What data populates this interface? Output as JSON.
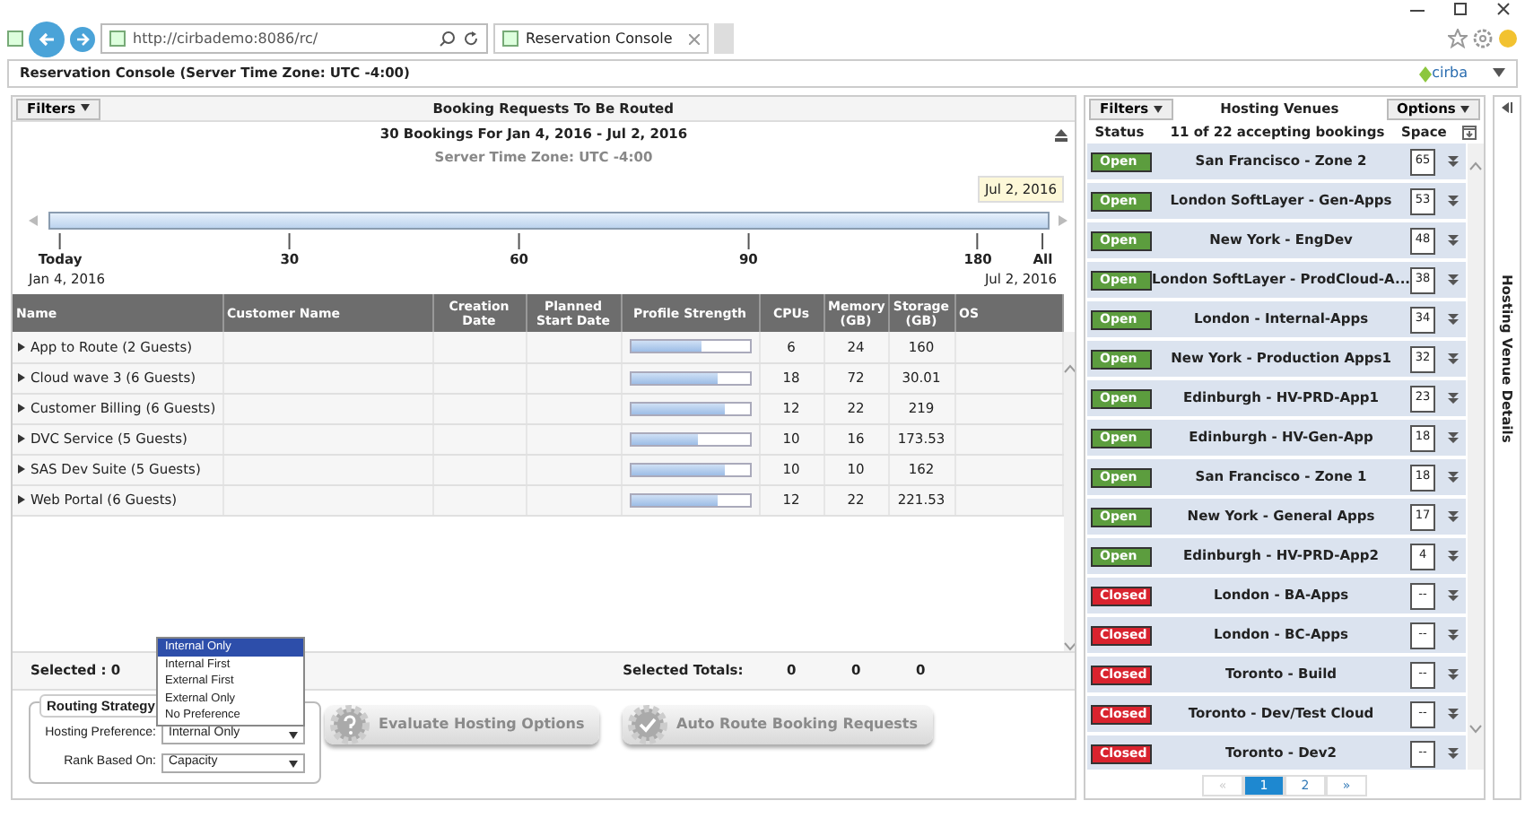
{
  "browser": {
    "address": "http://cirbademo:8086/rc/",
    "tab_title": "Reservation Console"
  },
  "app_title": "Reservation Console (Server Time Zone: UTC -4:00)",
  "logo": "cirba",
  "bookings": {
    "filters_label": "Filters",
    "title": "Booking Requests To Be Routed",
    "range": "30 Bookings For Jan 4, 2016 - Jul 2, 2016",
    "time_zone": "Server Time Zone: UTC -4:00",
    "timeline": {
      "level": 1,
      "tooltip": "Jul 2, 2016",
      "ticks": [
        "Today",
        "30",
        "60",
        "90",
        "180",
        "All"
      ],
      "start": "Jan 4, 2016",
      "end": "Jul 2, 2016"
    },
    "columns": [
      "Name",
      "Customer Name",
      "Creation Date",
      "Planned Start Date",
      "Profile Strength",
      "CPUs",
      "Memory (GB)",
      "Storage (GB)",
      "OS"
    ],
    "rows": [
      {
        "name": "App to Route (2 Guests)",
        "level": 0.6,
        "cpus": "6",
        "memory": "24",
        "storage": "160"
      },
      {
        "name": "Cloud wave 3 (6 Guests)",
        "level": 0.73,
        "cpus": "18",
        "memory": "72",
        "storage": "30.01"
      },
      {
        "name": "Customer Billing (6 Guests)",
        "level": 0.8,
        "cpus": "12",
        "memory": "22",
        "storage": "219"
      },
      {
        "name": "DVC Service (5 Guests)",
        "level": 0.57,
        "cpus": "10",
        "memory": "16",
        "storage": "173.53"
      },
      {
        "name": "SAS Dev Suite (5 Guests)",
        "level": 0.8,
        "cpus": "10",
        "memory": "10",
        "storage": "162"
      },
      {
        "name": "Web Portal (6 Guests)",
        "level": 0.73,
        "cpus": "12",
        "memory": "22",
        "storage": "221.53"
      }
    ],
    "selected": "Selected : 0",
    "totals_label": "Selected Totals:",
    "totals": [
      "0",
      "0",
      "0"
    ]
  },
  "routing": {
    "legend": "Routing Strategy",
    "fields": [
      {
        "label": "Hosting Preference:",
        "value": "Internal Only"
      },
      {
        "label": "Rank Based On:",
        "value": "Capacity"
      }
    ],
    "menu": [
      {
        "label": "Internal Only",
        "selected": true
      },
      {
        "label": "Internal First",
        "selected": false
      },
      {
        "label": "External First",
        "selected": false
      },
      {
        "label": "External Only",
        "selected": false
      },
      {
        "label": "No Preference",
        "selected": false
      }
    ]
  },
  "actions": [
    {
      "kind": "evaluate",
      "label": "Evaluate Hosting Options",
      "disabled": true
    },
    {
      "kind": "auto",
      "label": "Auto Route Booking Requests",
      "disabled": true
    }
  ],
  "venues": {
    "filters_label": "Filters",
    "title": "Hosting Venues",
    "options_label": "Options",
    "status_heading": "Status",
    "summary": "11 of 22 accepting bookings",
    "space_heading": "Space",
    "items": [
      {
        "status": "Open",
        "open": true,
        "name": "San Francisco - Zone 2",
        "space": "65"
      },
      {
        "status": "Open",
        "open": true,
        "name": "London SoftLayer - Gen-Apps",
        "space": "53"
      },
      {
        "status": "Open",
        "open": true,
        "name": "New York - EngDev",
        "space": "48"
      },
      {
        "status": "Open",
        "open": true,
        "name": "London SoftLayer - ProdCloud-A...",
        "space": "38"
      },
      {
        "status": "Open",
        "open": true,
        "name": "London - Internal-Apps",
        "space": "34"
      },
      {
        "status": "Open",
        "open": true,
        "name": "New York - Production Apps1",
        "space": "32"
      },
      {
        "status": "Open",
        "open": true,
        "name": "Edinburgh - HV-PRD-App1",
        "space": "23"
      },
      {
        "status": "Open",
        "open": true,
        "name": "Edinburgh - HV-Gen-App",
        "space": "18"
      },
      {
        "status": "Open",
        "open": true,
        "name": "San Francisco - Zone 1",
        "space": "18"
      },
      {
        "status": "Open",
        "open": true,
        "name": "New York - General Apps",
        "space": "17"
      },
      {
        "status": "Open",
        "open": true,
        "name": "Edinburgh - HV-PRD-App2",
        "space": "4"
      },
      {
        "status": "Closed",
        "open": false,
        "name": "London - BA-Apps",
        "space": "--"
      },
      {
        "status": "Closed",
        "open": false,
        "name": "London - BC-Apps",
        "space": "--"
      },
      {
        "status": "Closed",
        "open": false,
        "name": "Toronto - Build",
        "space": "--"
      },
      {
        "status": "Closed",
        "open": false,
        "name": "Toronto - Dev/Test Cloud",
        "space": "--"
      },
      {
        "status": "Closed",
        "open": false,
        "name": "Toronto - Dev2",
        "space": "--"
      }
    ],
    "pages": [
      {
        "label": "«",
        "selected": false,
        "disabled": true
      },
      {
        "label": "1",
        "selected": true,
        "disabled": false
      },
      {
        "label": "2",
        "selected": false,
        "disabled": false
      },
      {
        "label": "»",
        "selected": false,
        "disabled": false
      }
    ]
  },
  "side_tab": "Hosting Venue Details"
}
